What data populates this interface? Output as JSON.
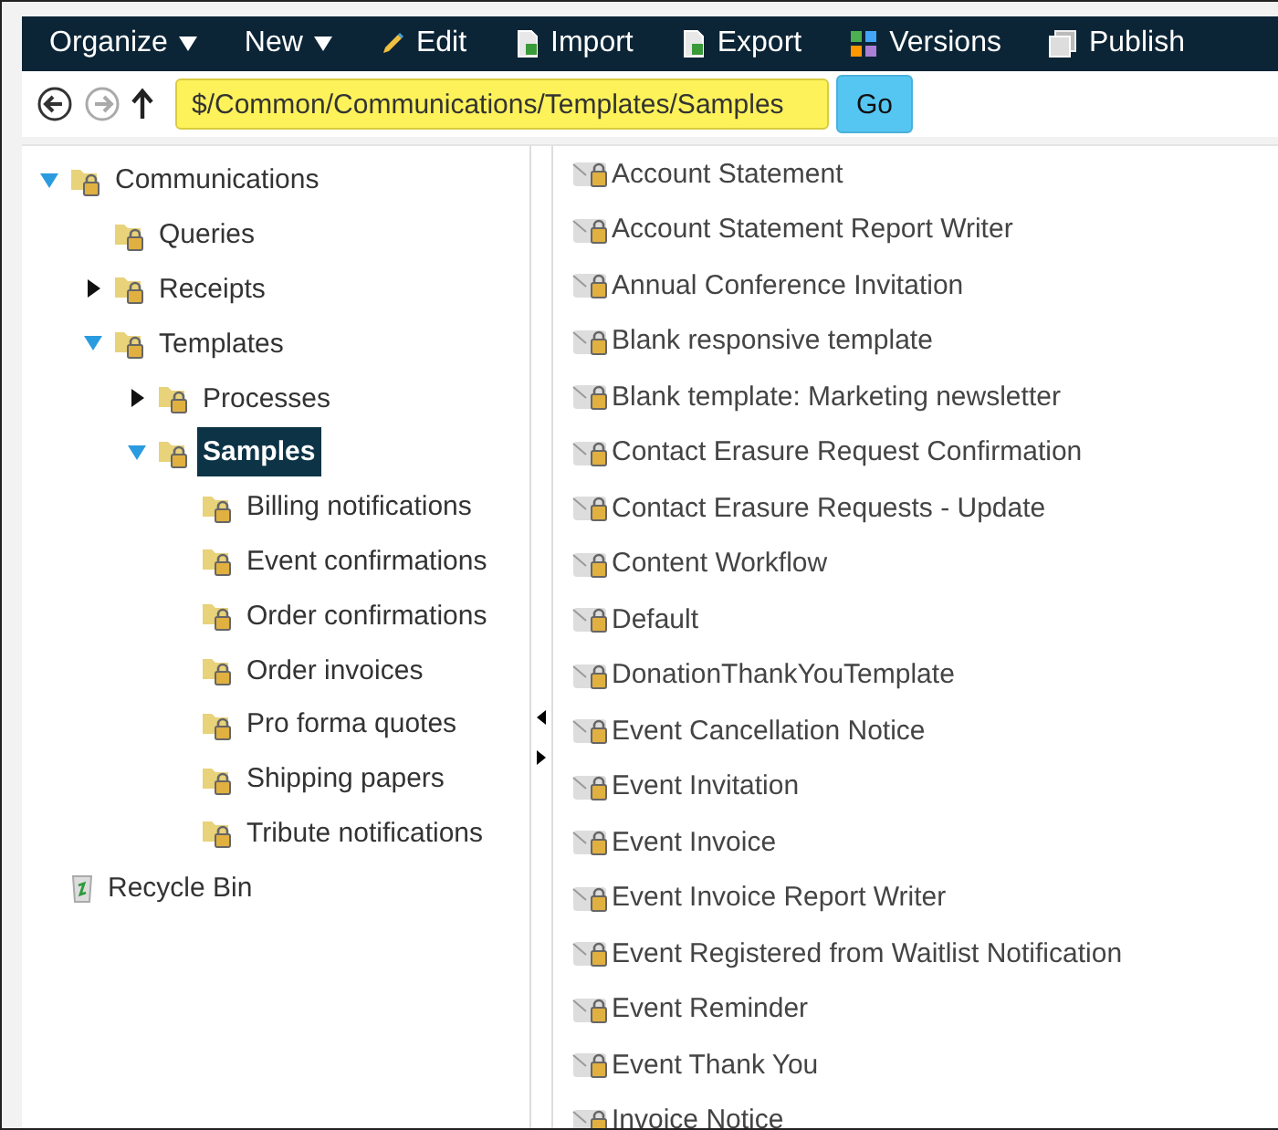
{
  "toolbar": [
    {
      "label": "Organize",
      "kind": "menu"
    },
    {
      "label": "New",
      "kind": "menu"
    },
    {
      "label": "Edit",
      "kind": "edit"
    },
    {
      "label": "Import",
      "kind": "import"
    },
    {
      "label": "Export",
      "kind": "export"
    },
    {
      "label": "Versions",
      "kind": "versions"
    },
    {
      "label": "Publish",
      "kind": "publish"
    }
  ],
  "address_bar": {
    "back_disabled": false,
    "forward_disabled": true,
    "path": "$/Common/Communications/Templates/Samples",
    "go_button": "Go"
  },
  "tree": [
    {
      "label": "Communications",
      "kind": "folder",
      "expanded": true,
      "selected": false,
      "children": [
        {
          "label": "Queries",
          "kind": "folder",
          "selected": false
        },
        {
          "label": "Receipts",
          "kind": "folder",
          "expanded": false,
          "selected": false
        },
        {
          "label": "Templates",
          "kind": "folder",
          "expanded": true,
          "selected": false,
          "children": [
            {
              "label": "Processes",
              "kind": "folder",
              "expanded": false,
              "selected": false
            },
            {
              "label": "Samples",
              "kind": "folder",
              "expanded": true,
              "selected": true,
              "children": [
                {
                  "label": "Billing notifications",
                  "kind": "folder",
                  "selected": false
                },
                {
                  "label": "Event confirmations",
                  "kind": "folder",
                  "selected": false
                },
                {
                  "label": "Order confirmations",
                  "kind": "folder",
                  "selected": false
                },
                {
                  "label": "Order invoices",
                  "kind": "folder",
                  "selected": false
                },
                {
                  "label": "Pro forma quotes",
                  "kind": "folder",
                  "selected": false
                },
                {
                  "label": "Shipping papers",
                  "kind": "folder",
                  "selected": false
                },
                {
                  "label": "Tribute notifications",
                  "kind": "folder",
                  "selected": false
                }
              ]
            }
          ]
        }
      ]
    },
    {
      "label": "Recycle Bin",
      "kind": "recycle-bin",
      "selected": false
    }
  ],
  "templates": [
    "Account Statement",
    "Account Statement Report Writer",
    "Annual Conference Invitation",
    "Blank responsive template",
    "Blank template: Marketing newsletter",
    "Contact Erasure Request Confirmation",
    "Contact Erasure Requests - Update",
    "Content Workflow",
    "Default",
    "DonationThankYouTemplate",
    "Event Cancellation Notice",
    "Event Invitation",
    "Event Invoice",
    "Event Invoice Report Writer",
    "Event Registered from Waitlist Notification",
    "Event Reminder",
    "Event Thank You",
    "Invoice Notice"
  ]
}
